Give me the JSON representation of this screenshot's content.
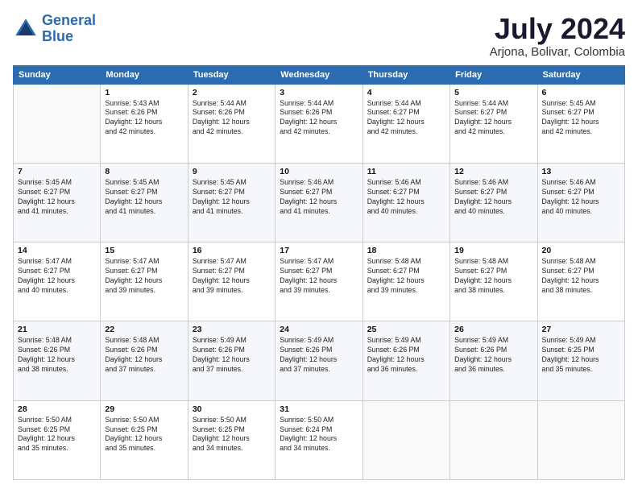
{
  "logo": {
    "line1": "General",
    "line2": "Blue"
  },
  "header": {
    "month": "July 2024",
    "location": "Arjona, Bolivar, Colombia"
  },
  "days_of_week": [
    "Sunday",
    "Monday",
    "Tuesday",
    "Wednesday",
    "Thursday",
    "Friday",
    "Saturday"
  ],
  "weeks": [
    [
      {
        "day": "",
        "info": ""
      },
      {
        "day": "1",
        "info": "Sunrise: 5:43 AM\nSunset: 6:26 PM\nDaylight: 12 hours\nand 42 minutes."
      },
      {
        "day": "2",
        "info": "Sunrise: 5:44 AM\nSunset: 6:26 PM\nDaylight: 12 hours\nand 42 minutes."
      },
      {
        "day": "3",
        "info": "Sunrise: 5:44 AM\nSunset: 6:26 PM\nDaylight: 12 hours\nand 42 minutes."
      },
      {
        "day": "4",
        "info": "Sunrise: 5:44 AM\nSunset: 6:27 PM\nDaylight: 12 hours\nand 42 minutes."
      },
      {
        "day": "5",
        "info": "Sunrise: 5:44 AM\nSunset: 6:27 PM\nDaylight: 12 hours\nand 42 minutes."
      },
      {
        "day": "6",
        "info": "Sunrise: 5:45 AM\nSunset: 6:27 PM\nDaylight: 12 hours\nand 42 minutes."
      }
    ],
    [
      {
        "day": "7",
        "info": "Sunrise: 5:45 AM\nSunset: 6:27 PM\nDaylight: 12 hours\nand 41 minutes."
      },
      {
        "day": "8",
        "info": "Sunrise: 5:45 AM\nSunset: 6:27 PM\nDaylight: 12 hours\nand 41 minutes."
      },
      {
        "day": "9",
        "info": "Sunrise: 5:45 AM\nSunset: 6:27 PM\nDaylight: 12 hours\nand 41 minutes."
      },
      {
        "day": "10",
        "info": "Sunrise: 5:46 AM\nSunset: 6:27 PM\nDaylight: 12 hours\nand 41 minutes."
      },
      {
        "day": "11",
        "info": "Sunrise: 5:46 AM\nSunset: 6:27 PM\nDaylight: 12 hours\nand 40 minutes."
      },
      {
        "day": "12",
        "info": "Sunrise: 5:46 AM\nSunset: 6:27 PM\nDaylight: 12 hours\nand 40 minutes."
      },
      {
        "day": "13",
        "info": "Sunrise: 5:46 AM\nSunset: 6:27 PM\nDaylight: 12 hours\nand 40 minutes."
      }
    ],
    [
      {
        "day": "14",
        "info": "Sunrise: 5:47 AM\nSunset: 6:27 PM\nDaylight: 12 hours\nand 40 minutes."
      },
      {
        "day": "15",
        "info": "Sunrise: 5:47 AM\nSunset: 6:27 PM\nDaylight: 12 hours\nand 39 minutes."
      },
      {
        "day": "16",
        "info": "Sunrise: 5:47 AM\nSunset: 6:27 PM\nDaylight: 12 hours\nand 39 minutes."
      },
      {
        "day": "17",
        "info": "Sunrise: 5:47 AM\nSunset: 6:27 PM\nDaylight: 12 hours\nand 39 minutes."
      },
      {
        "day": "18",
        "info": "Sunrise: 5:48 AM\nSunset: 6:27 PM\nDaylight: 12 hours\nand 39 minutes."
      },
      {
        "day": "19",
        "info": "Sunrise: 5:48 AM\nSunset: 6:27 PM\nDaylight: 12 hours\nand 38 minutes."
      },
      {
        "day": "20",
        "info": "Sunrise: 5:48 AM\nSunset: 6:27 PM\nDaylight: 12 hours\nand 38 minutes."
      }
    ],
    [
      {
        "day": "21",
        "info": "Sunrise: 5:48 AM\nSunset: 6:26 PM\nDaylight: 12 hours\nand 38 minutes."
      },
      {
        "day": "22",
        "info": "Sunrise: 5:48 AM\nSunset: 6:26 PM\nDaylight: 12 hours\nand 37 minutes."
      },
      {
        "day": "23",
        "info": "Sunrise: 5:49 AM\nSunset: 6:26 PM\nDaylight: 12 hours\nand 37 minutes."
      },
      {
        "day": "24",
        "info": "Sunrise: 5:49 AM\nSunset: 6:26 PM\nDaylight: 12 hours\nand 37 minutes."
      },
      {
        "day": "25",
        "info": "Sunrise: 5:49 AM\nSunset: 6:26 PM\nDaylight: 12 hours\nand 36 minutes."
      },
      {
        "day": "26",
        "info": "Sunrise: 5:49 AM\nSunset: 6:26 PM\nDaylight: 12 hours\nand 36 minutes."
      },
      {
        "day": "27",
        "info": "Sunrise: 5:49 AM\nSunset: 6:25 PM\nDaylight: 12 hours\nand 35 minutes."
      }
    ],
    [
      {
        "day": "28",
        "info": "Sunrise: 5:50 AM\nSunset: 6:25 PM\nDaylight: 12 hours\nand 35 minutes."
      },
      {
        "day": "29",
        "info": "Sunrise: 5:50 AM\nSunset: 6:25 PM\nDaylight: 12 hours\nand 35 minutes."
      },
      {
        "day": "30",
        "info": "Sunrise: 5:50 AM\nSunset: 6:25 PM\nDaylight: 12 hours\nand 34 minutes."
      },
      {
        "day": "31",
        "info": "Sunrise: 5:50 AM\nSunset: 6:24 PM\nDaylight: 12 hours\nand 34 minutes."
      },
      {
        "day": "",
        "info": ""
      },
      {
        "day": "",
        "info": ""
      },
      {
        "day": "",
        "info": ""
      }
    ]
  ]
}
